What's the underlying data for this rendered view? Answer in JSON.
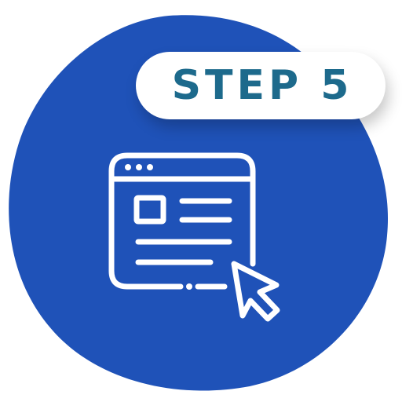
{
  "badge": {
    "label": "STEP 5"
  },
  "icons": {
    "main": "browser-window-click-icon"
  },
  "colors": {
    "blob": "#1f52b8",
    "badge_text": "#1d6a8c",
    "badge_background": "#ffffff",
    "icon_stroke": "#ffffff"
  }
}
